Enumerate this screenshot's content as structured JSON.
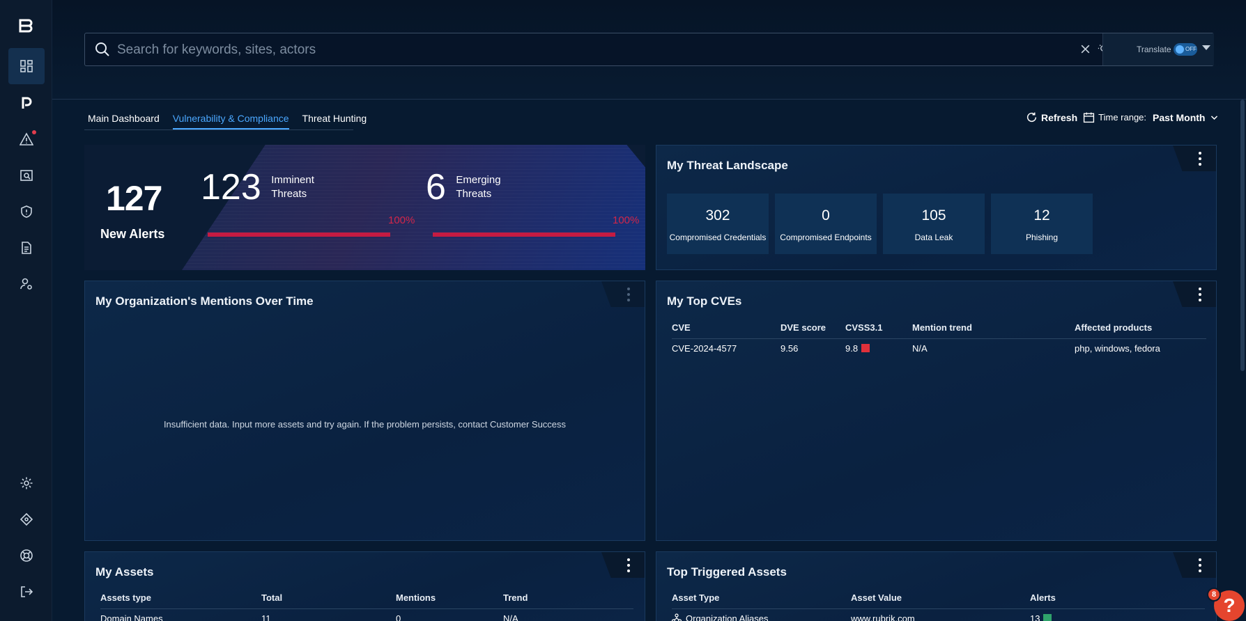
{
  "search": {
    "placeholder": "Search for keywords, sites, actors"
  },
  "translate": {
    "label": "Translate",
    "toggle_state": "OFF"
  },
  "tabs": [
    "Main Dashboard",
    "Vulnerability & Compliance",
    "Threat Hunting"
  ],
  "active_tab": "Vulnerability & Compliance",
  "header_controls": {
    "refresh_label": "Refresh",
    "time_range_label": "Time range:",
    "time_range_value": "Past Month"
  },
  "alerts": {
    "new_alerts_count": "127",
    "new_alerts_label": "New Alerts",
    "imminent": {
      "count": "123",
      "label_line1": "Imminent",
      "label_line2": "Threats",
      "percent": "100%",
      "fill": 1.0
    },
    "emerging": {
      "count": "6",
      "label_line1": "Emerging",
      "label_line2": "Threats",
      "percent": "100%",
      "fill": 1.0
    }
  },
  "threat_landscape": {
    "title": "My Threat Landscape",
    "tiles": [
      {
        "value": "302",
        "label": "Compromised Credentials"
      },
      {
        "value": "0",
        "label": "Compromised Endpoints"
      },
      {
        "value": "105",
        "label": "Data Leak"
      },
      {
        "value": "12",
        "label": "Phishing"
      }
    ]
  },
  "mentions": {
    "title": "My Organization's Mentions Over Time",
    "message": "Insufficient data. Input more assets and try again. If the problem persists, contact Customer Success"
  },
  "top_cves": {
    "title": "My Top CVEs",
    "headers": [
      "CVE",
      "DVE score",
      "CVSS3.1",
      "Mention trend",
      "Affected products"
    ],
    "rows": [
      {
        "cve": "CVE-2024-4577",
        "dve": "9.56",
        "cvss": "9.8",
        "trend": "N/A",
        "products": "php, windows, fedora",
        "severity_color": "#e0303a"
      }
    ]
  },
  "assets": {
    "title": "My Assets",
    "headers": [
      "Assets type",
      "Total",
      "Mentions",
      "Trend"
    ],
    "rows": [
      {
        "type": "Domain Names",
        "total": "11",
        "mentions": "0",
        "trend": "N/A"
      }
    ]
  },
  "triggered": {
    "title": "Top Triggered Assets",
    "headers": [
      "Asset Type",
      "Asset Value",
      "Alerts"
    ],
    "rows": [
      {
        "type": "Organization Aliases",
        "value": "www.rubrik.com",
        "alerts": "13",
        "color": "#2fa36b"
      }
    ]
  },
  "help": {
    "badge_count": "8",
    "icon": "?"
  },
  "colors": {
    "accent": "#4ba8ff",
    "alert_red": "#c51b42",
    "background": "#071a30"
  },
  "sidebar_icons": [
    "logo-icon",
    "dashboard-icon",
    "p-icon",
    "alert-icon",
    "search-doc-icon",
    "shield-icon",
    "document-icon",
    "user-settings-icon",
    "gear-icon",
    "integrations-icon",
    "support-icon",
    "logout-icon"
  ]
}
